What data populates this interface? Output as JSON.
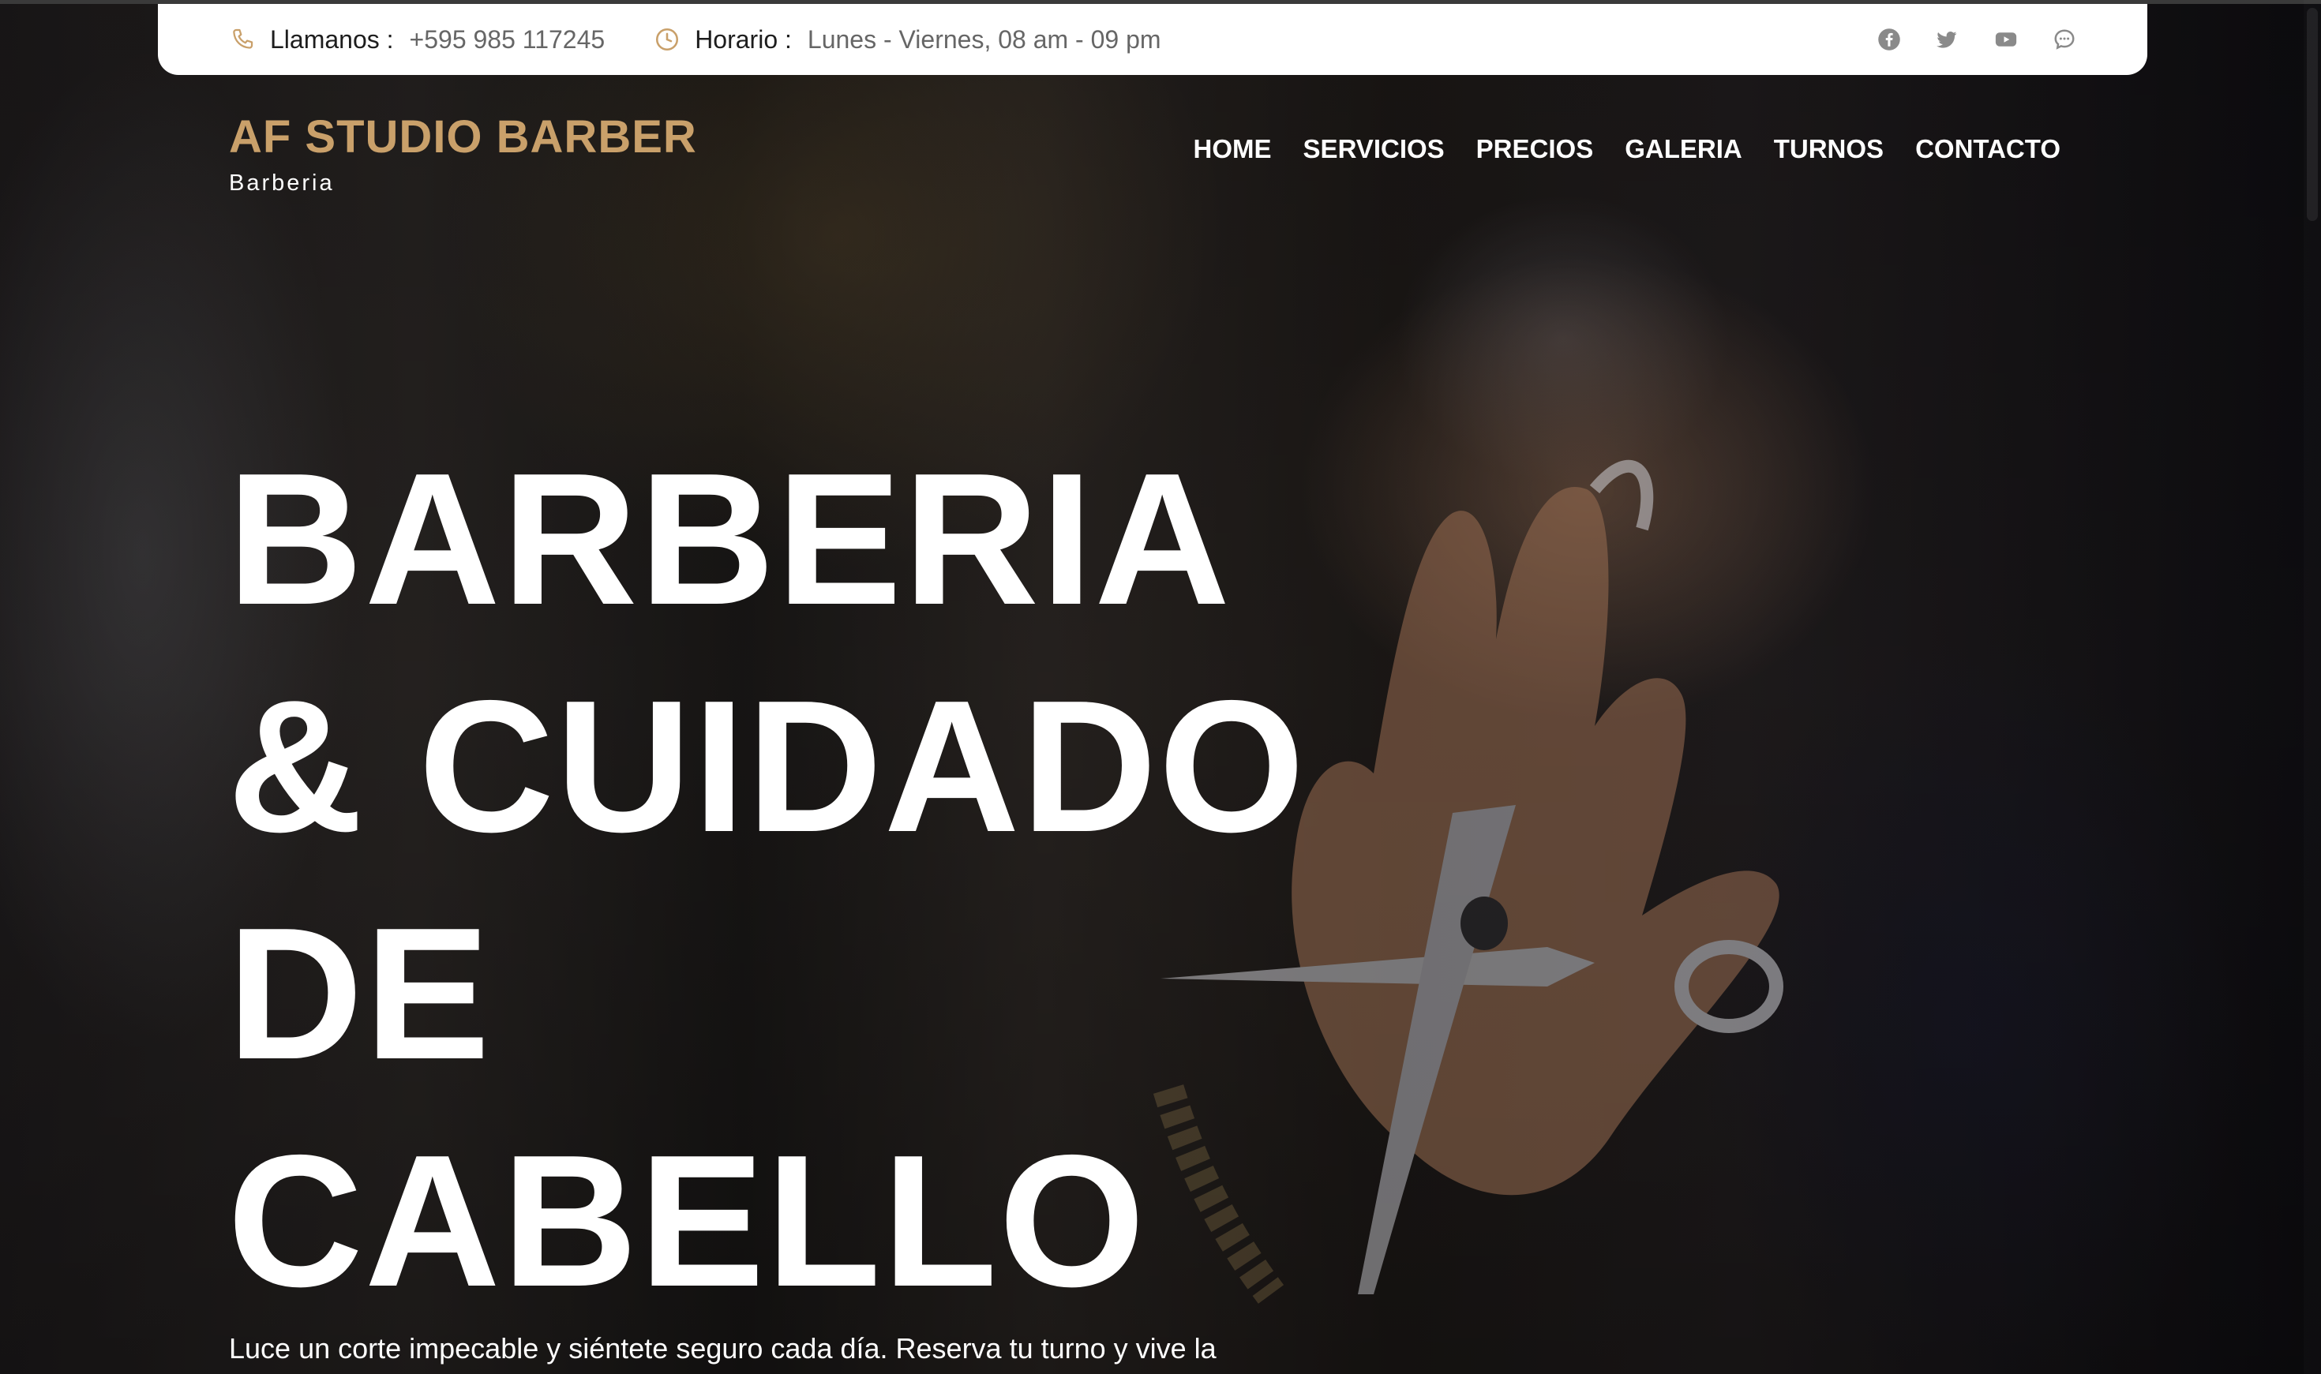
{
  "topbar": {
    "phone_label": "Llamanos :",
    "phone_value": "+595 985 117245",
    "hours_label": "Horario :",
    "hours_value": "Lunes - Viernes, 08 am - 09 pm",
    "socials": [
      "facebook-icon",
      "twitter-icon",
      "youtube-icon",
      "chat-icon"
    ],
    "icon_color": "#c9a06a"
  },
  "brand": {
    "name": "AF STUDIO BARBER",
    "tagline": "Barberia",
    "color": "#c9a06a"
  },
  "nav": {
    "items": [
      "HOME",
      "SERVICIOS",
      "PRECIOS",
      "GALERIA",
      "TURNOS",
      "CONTACTO"
    ]
  },
  "hero": {
    "title_lines": [
      "BARBERIA",
      "& CUIDADO",
      "DE",
      "CABELLO"
    ],
    "subtitle": "Luce un corte impecable y siéntete seguro cada día. Reserva tu turno y vive la"
  }
}
